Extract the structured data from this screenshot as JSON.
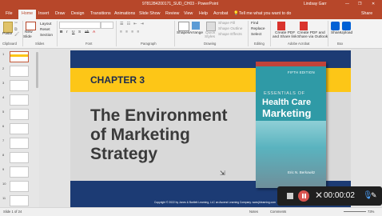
{
  "window": {
    "title": "9781284200171_SUD_CH03 - PowerPoint",
    "search": "Tell me what you want to do",
    "user": "Lindsay Garr",
    "share": "Share"
  },
  "tabs": [
    "File",
    "Home",
    "Insert",
    "Draw",
    "Design",
    "Transitions",
    "Animations",
    "Slide Show",
    "Review",
    "View",
    "Help",
    "Acrobat"
  ],
  "active_tab": "Home",
  "ribbon": {
    "clipboard": {
      "paste": "Paste",
      "label": "Clipboard"
    },
    "slides": {
      "new_slide": "New",
      "new_slide2": "Slide",
      "layout": "Layout",
      "reset": "Reset",
      "section": "Section",
      "label": "Slides"
    },
    "font": {
      "label": "Font"
    },
    "paragraph": {
      "label": "Paragraph"
    },
    "drawing": {
      "shapes": "Shapes",
      "arrange": "Arrange",
      "quick": "Quick",
      "styles": "Styles",
      "shape_fill": "Shape Fill",
      "shape_outline": "Shape Outline",
      "shape_effects": "Shape Effects",
      "label": "Drawing"
    },
    "editing": {
      "find": "Find",
      "replace": "Replace",
      "select": "Select",
      "label": "Editing"
    },
    "acrobat": {
      "create1": "Create PDF",
      "create1b": "and Share link",
      "create2": "Create PDF and",
      "create2b": "Share via Outlook",
      "label": "Adobe Acrobat"
    },
    "box": {
      "share": "Share",
      "upload": "Upload",
      "label": "Box"
    }
  },
  "thumbnails": [
    "1",
    "2",
    "3",
    "4",
    "5",
    "6",
    "7",
    "8",
    "9",
    "10",
    "11"
  ],
  "slide": {
    "chapter": "CHAPTER 3",
    "title_line1": "The Environment",
    "title_line2": "of Marketing",
    "title_line3": "Strategy",
    "copyright": "Copyright © 2022 by Jones & Bartlett Learning, LLC an Ascend Learning Company. www.jblearning.com",
    "book": {
      "edition": "FIFTH EDITION",
      "essentials": "ESSENTIALS OF",
      "title1": "Health Care",
      "title2": "Marketing",
      "author": "Eric N. Berkowitz"
    }
  },
  "status": {
    "slide": "Slide 1 of 24",
    "notes": "Notes",
    "comments": "Comments",
    "zoom": "73%"
  },
  "recorder": {
    "time": "00:00:02"
  }
}
